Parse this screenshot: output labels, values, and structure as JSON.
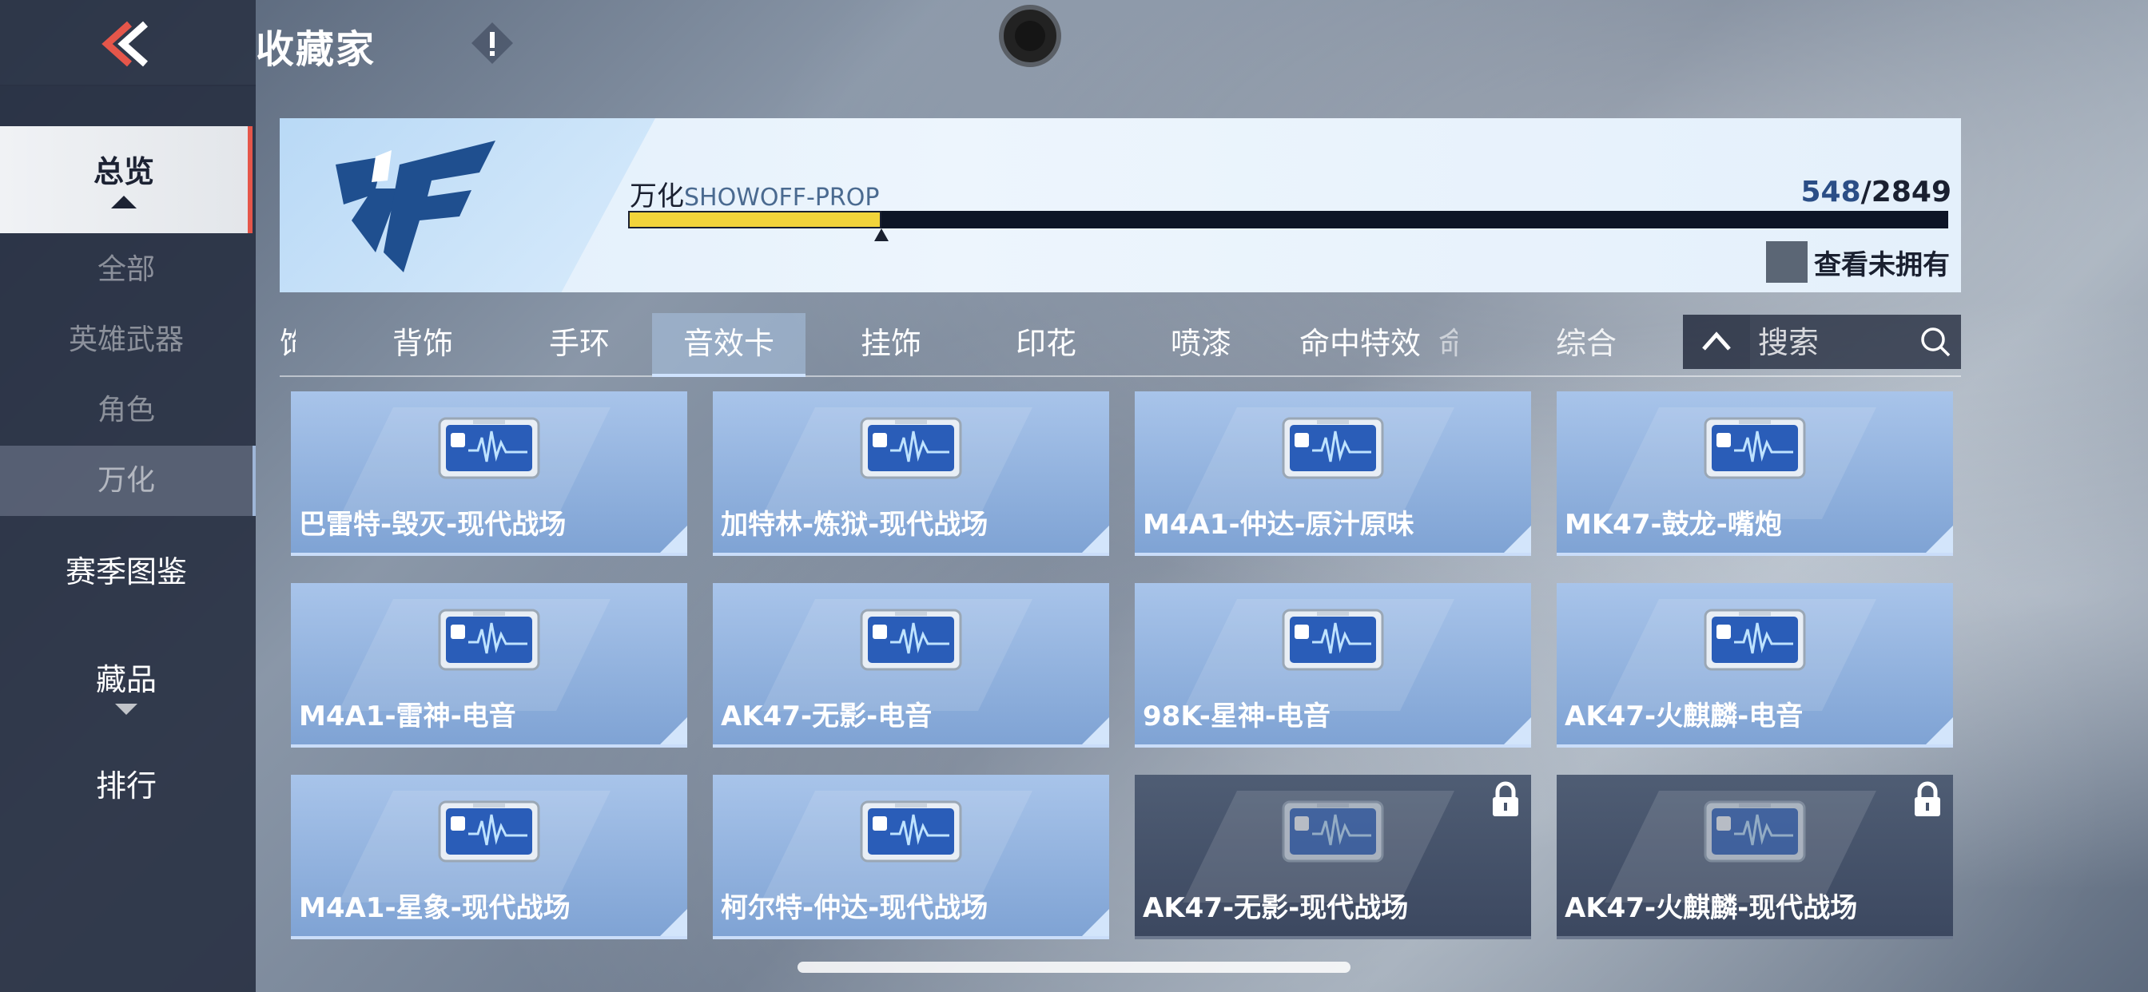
{
  "header": {
    "title": "收藏家"
  },
  "sidebar": {
    "items": [
      {
        "label": "总览"
      },
      {
        "label": "赛季图鉴"
      },
      {
        "label": "藏品"
      },
      {
        "label": "排行"
      }
    ],
    "sub_items": [
      {
        "label": "全部"
      },
      {
        "label": "英雄武器"
      },
      {
        "label": "角色"
      },
      {
        "label": "万化"
      }
    ]
  },
  "banner": {
    "label_cn": "万化",
    "label_en": "SHOWOFF-PROP",
    "owned": "548",
    "total": "/2849",
    "progress": 0.192,
    "unowned_toggle_label": "查看未拥有"
  },
  "tabs": {
    "items": [
      {
        "label": "饰"
      },
      {
        "label": "背饰"
      },
      {
        "label": "手环"
      },
      {
        "label": "音效卡"
      },
      {
        "label": "挂饰"
      },
      {
        "label": "印花"
      },
      {
        "label": "喷漆"
      },
      {
        "label": "命中特效"
      },
      {
        "label": "命"
      }
    ],
    "active": "音效卡",
    "sort_label": "综合",
    "collapse_icon": "chevron-up-icon"
  },
  "search": {
    "placeholder": "搜索"
  },
  "cards": [
    {
      "label": "巴雷特-毁灭-现代战场",
      "locked": false
    },
    {
      "label": "加特林-炼狱-现代战场",
      "locked": false
    },
    {
      "label": "M4A1-仲达-原汁原味",
      "locked": false
    },
    {
      "label": "MK47-鼓龙-嘴炮",
      "locked": false
    },
    {
      "label": "M4A1-雷神-电音",
      "locked": false
    },
    {
      "label": "AK47-无影-电音",
      "locked": false
    },
    {
      "label": "98K-星神-电音",
      "locked": false
    },
    {
      "label": "AK47-火麒麟-电音",
      "locked": false
    },
    {
      "label": "M4A1-星象-现代战场",
      "locked": false
    },
    {
      "label": "柯尔特-仲达-现代战场",
      "locked": false
    },
    {
      "label": "AK47-无影-现代战场",
      "locked": true
    },
    {
      "label": "AK47-火麒麟-现代战场",
      "locked": true
    }
  ],
  "colors": {
    "progress_fill": "#f2d43a",
    "active_side_accent": "#e5564a",
    "card_bg": "#8eb0dd",
    "locked_card_bg": "#46536a"
  }
}
